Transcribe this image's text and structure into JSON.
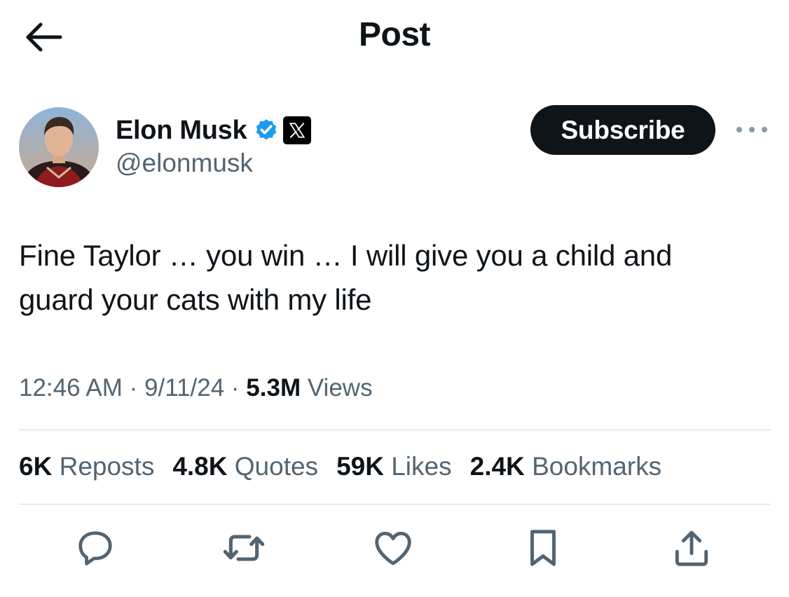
{
  "header": {
    "title": "Post",
    "back_icon": "arrow-left-icon"
  },
  "author": {
    "display_name": "Elon Musk",
    "handle": "@elonmusk",
    "verified_icon": "verified-badge-icon",
    "verified_color": "#1d9bf0",
    "affiliate_icon": "x-logo-icon"
  },
  "subscribe_label": "Subscribe",
  "more_icon": "more-dots-icon",
  "tweet": {
    "text": "Fine Taylor … you win … I will give you a child and\nguard your cats with my life"
  },
  "meta": {
    "time": "12:46 AM",
    "sep1": " · ",
    "date": "9/11/24",
    "sep2": " · ",
    "views_count": "5.3M",
    "views_label": " Views"
  },
  "stats": [
    {
      "count": "6K",
      "label": "Reposts"
    },
    {
      "count": "4.8K",
      "label": "Quotes"
    },
    {
      "count": "59K",
      "label": "Likes"
    },
    {
      "count": "2.4K",
      "label": "Bookmarks"
    }
  ],
  "actions": [
    {
      "name": "reply",
      "icon": "reply-icon"
    },
    {
      "name": "repost",
      "icon": "repost-icon"
    },
    {
      "name": "like",
      "icon": "heart-icon"
    },
    {
      "name": "bookmark",
      "icon": "bookmark-icon"
    },
    {
      "name": "share",
      "icon": "share-icon"
    }
  ],
  "colors": {
    "text_primary": "#0f1419",
    "text_secondary": "#536471",
    "divider": "#cfd9de",
    "button_bg": "#0f1419"
  }
}
